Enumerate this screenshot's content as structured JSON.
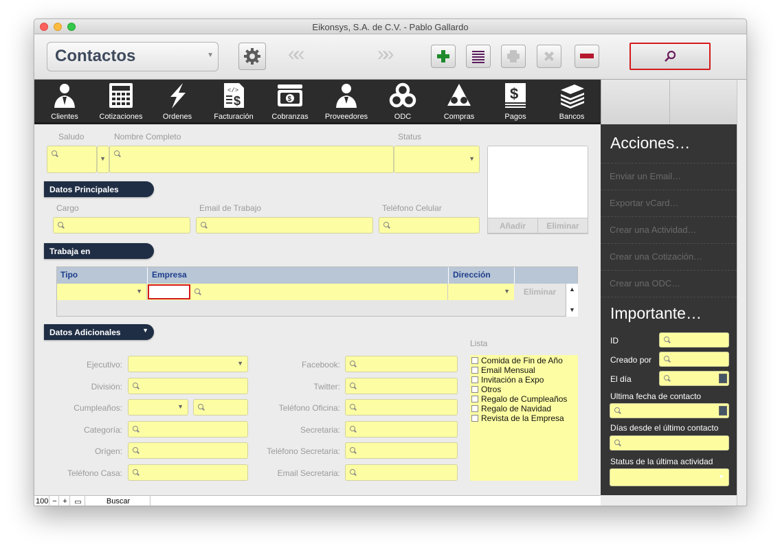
{
  "window": {
    "title": "Eikonsys, S.A. de C.V. - Pablo Gallardo"
  },
  "toolbar": {
    "layout_label": "Contactos",
    "prev_arrows": "«",
    "next_arrows": "»"
  },
  "nav": [
    {
      "label": "Clientes",
      "icon": "clients-icon"
    },
    {
      "label": "Cotizaciones",
      "icon": "calculator-icon"
    },
    {
      "label": "Ordenes",
      "icon": "lightning-icon"
    },
    {
      "label": "Facturación",
      "icon": "invoice-icon"
    },
    {
      "label": "Cobranzas",
      "icon": "cash-icon"
    },
    {
      "label": "Proveedores",
      "icon": "suppliers-icon"
    },
    {
      "label": "ODC",
      "icon": "rings-icon"
    },
    {
      "label": "Compras",
      "icon": "triangle-rings-icon"
    },
    {
      "label": "Pagos",
      "icon": "dollar-icon"
    },
    {
      "label": "Bancos",
      "icon": "stack-icon"
    }
  ],
  "top_fields": {
    "saludo": "Saludo",
    "nombre": "Nombre Completo",
    "status": "Status"
  },
  "sections": {
    "principales": "Datos Principales",
    "trabaja": "Trabaja en",
    "adicionales": "Datos Adicionales"
  },
  "principales": {
    "cargo": "Cargo",
    "email": "Email de Trabajo",
    "celular": "Teléfono Celular"
  },
  "photo": {
    "add": "Añadir",
    "remove": "Eliminar"
  },
  "portal": {
    "col_tipo": "Tipo",
    "col_empresa": "Empresa",
    "col_direccion": "Dirección",
    "eliminar": "Eliminar"
  },
  "adicionales_left": [
    {
      "label": "Ejecutivo:"
    },
    {
      "label": "División:"
    },
    {
      "label": "Cumpleaños:"
    },
    {
      "label": "Categoría:"
    },
    {
      "label": "Orígen:"
    },
    {
      "label": "Teléfono Casa:"
    }
  ],
  "adicionales_mid": [
    {
      "label": "Facebook:"
    },
    {
      "label": "Twitter:"
    },
    {
      "label": "Teléfono Oficina:"
    },
    {
      "label": "Secretaria:"
    },
    {
      "label": "Teléfono Secretaria:"
    },
    {
      "label": "Email Secretaria:"
    }
  ],
  "lista": {
    "label": "Lista",
    "items": [
      "Comida de Fin de Año",
      "Email Mensual",
      "Invitación a Expo",
      "Otros",
      "Regalo de Cumpleaños",
      "Regalo de Navidad",
      "Revista de la Empresa"
    ]
  },
  "sidebar": {
    "acciones_title": "Acciones…",
    "acciones": [
      "Enviar un Email…",
      "Exportar vCard…",
      "Crear una Actividad…",
      "Crear una Cotización…",
      "Crear una ODC…"
    ],
    "importante_title": "Importante…",
    "id_label": "ID",
    "creado_label": "Creado por",
    "dia_label": "El día",
    "ultima_label": "Ultima fecha de contacto",
    "dias_label": "Días desde el último contacto",
    "status_label": "Status de la última actividad"
  },
  "status_bar": {
    "zoom": "100",
    "mode": "Buscar"
  },
  "colors": {
    "field": "#fdfda3",
    "nav_bg": "#2c2c2c",
    "section_header": "#1f2e45",
    "highlight": "#d3191c"
  }
}
